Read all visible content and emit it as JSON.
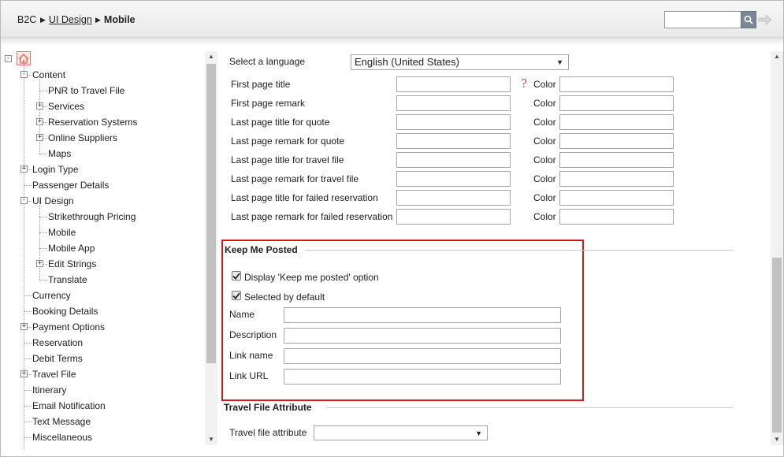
{
  "breadcrumb": {
    "root": "B2C",
    "parent": "UI Design",
    "current": "Mobile"
  },
  "search": {
    "placeholder": "",
    "value": ""
  },
  "icons": {
    "search": "search-icon",
    "go": "arrow-right-icon",
    "home": "home-icon"
  },
  "tree": {
    "items": [
      {
        "label": "Content",
        "expander": "-"
      },
      {
        "label": "PNR to Travel File",
        "expander": ""
      },
      {
        "label": "Services",
        "expander": "+"
      },
      {
        "label": "Reservation Systems",
        "expander": "+"
      },
      {
        "label": "Online Suppliers",
        "expander": "+"
      },
      {
        "label": "Maps",
        "expander": ""
      },
      {
        "label": "Login Type",
        "expander": "+"
      },
      {
        "label": "Passenger Details",
        "expander": ""
      },
      {
        "label": "UI Design",
        "expander": "-"
      },
      {
        "label": "Strikethrough Pricing",
        "expander": ""
      },
      {
        "label": "Mobile",
        "expander": ""
      },
      {
        "label": "Mobile App",
        "expander": ""
      },
      {
        "label": "Edit Strings",
        "expander": "+"
      },
      {
        "label": "Translate",
        "expander": ""
      },
      {
        "label": "Currency",
        "expander": ""
      },
      {
        "label": "Booking Details",
        "expander": ""
      },
      {
        "label": "Payment Options",
        "expander": "+"
      },
      {
        "label": "Reservation",
        "expander": ""
      },
      {
        "label": "Debit Terms",
        "expander": ""
      },
      {
        "label": "Travel File",
        "expander": "+"
      },
      {
        "label": "Itinerary",
        "expander": ""
      },
      {
        "label": "Email Notification",
        "expander": ""
      },
      {
        "label": "Text Message",
        "expander": ""
      },
      {
        "label": "Miscellaneous",
        "expander": ""
      }
    ]
  },
  "language": {
    "label": "Select a language",
    "selected": "English (United States)"
  },
  "color_label": "Color",
  "page_fields": [
    {
      "label": "First page title",
      "value": "",
      "color": ""
    },
    {
      "label": "First page remark",
      "value": "",
      "color": ""
    },
    {
      "label": "Last page title for quote",
      "value": "",
      "color": ""
    },
    {
      "label": "Last page remark for quote",
      "value": "",
      "color": ""
    },
    {
      "label": "Last page title for travel file",
      "value": "",
      "color": ""
    },
    {
      "label": "Last page remark for travel file",
      "value": "",
      "color": ""
    },
    {
      "label": "Last page title for failed reservation",
      "value": "",
      "color": ""
    },
    {
      "label": "Last page remark for failed reservation",
      "value": "",
      "color": ""
    }
  ],
  "keep_me_posted": {
    "title": "Keep Me Posted",
    "option_display": {
      "label": "Display 'Keep me posted' option",
      "checked": true
    },
    "option_default": {
      "label": "Selected by default",
      "checked": true
    },
    "fields": [
      {
        "label": "Name",
        "value": ""
      },
      {
        "label": "Description",
        "value": ""
      },
      {
        "label": "Link name",
        "value": ""
      },
      {
        "label": "Link URL",
        "value": ""
      }
    ]
  },
  "travel_file_attribute": {
    "title": "Travel File Attribute",
    "label": "Travel file attribute",
    "selected": ""
  },
  "colors": {
    "highlight": "#d7191c",
    "help": "#d24b4b",
    "home": "#e07a6c"
  }
}
